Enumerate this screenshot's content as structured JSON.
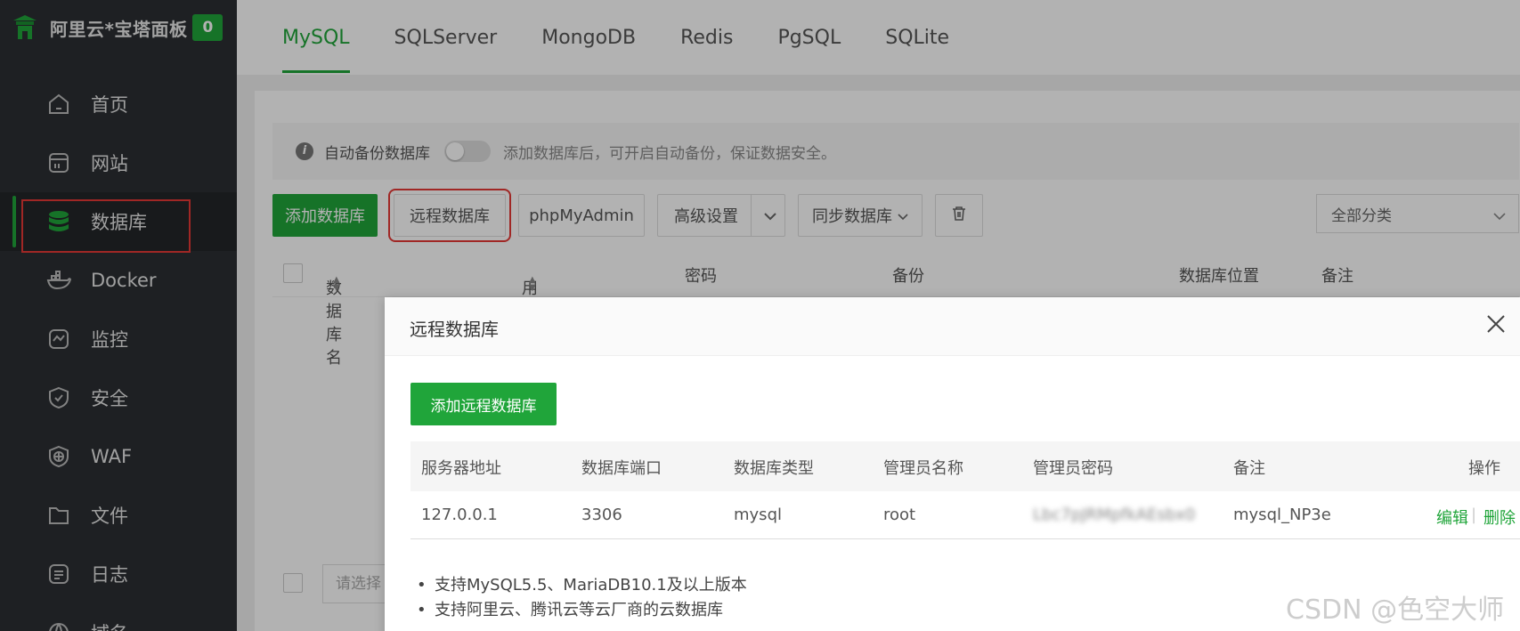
{
  "brand": {
    "name": "阿里云*宝塔面板",
    "badge": "0"
  },
  "sidebar": {
    "items": [
      {
        "label": "首页",
        "icon": "home-icon"
      },
      {
        "label": "网站",
        "icon": "website-icon"
      },
      {
        "label": "数据库",
        "icon": "database-icon",
        "active": true
      },
      {
        "label": "Docker",
        "icon": "docker-icon"
      },
      {
        "label": "监控",
        "icon": "monitor-icon"
      },
      {
        "label": "安全",
        "icon": "shield-icon"
      },
      {
        "label": "WAF",
        "icon": "waf-icon"
      },
      {
        "label": "文件",
        "icon": "folder-icon"
      },
      {
        "label": "日志",
        "icon": "log-icon"
      },
      {
        "label": "域名",
        "icon": "globe-icon"
      }
    ]
  },
  "tabs": [
    "MySQL",
    "SQLServer",
    "MongoDB",
    "Redis",
    "PgSQL",
    "SQLite"
  ],
  "notice": {
    "label": "自动备份数据库",
    "hint": "添加数据库后，可开启自动备份，保证数据安全。"
  },
  "toolbar": {
    "add_db": "添加数据库",
    "remote_db": "远程数据库",
    "phpmyadmin": "phpMyAdmin",
    "advanced": "高级设置",
    "sync": "同步数据库",
    "category": "全部分类"
  },
  "table": {
    "headers": [
      "数据库名",
      "用户名",
      "密码",
      "备份",
      "数据库位置",
      "备注"
    ]
  },
  "bottom": {
    "placeholder": "请选择"
  },
  "dialog": {
    "title": "远程数据库",
    "add_button": "添加远程数据库",
    "headers": [
      "服务器地址",
      "数据库端口",
      "数据库类型",
      "管理员名称",
      "管理员密码",
      "备注",
      "操作"
    ],
    "rows": [
      {
        "host": "127.0.0.1",
        "port": "3306",
        "type": "mysql",
        "admin": "root",
        "password": "Lbc7pJRMpfkAEsbx0",
        "note": "mysql_NP3e",
        "edit": "编辑",
        "delete": "删除"
      }
    ],
    "notes": [
      "支持MySQL5.5、MariaDB10.1及以上版本",
      "支持阿里云、腾讯云等云厂商的云数据库"
    ]
  },
  "watermark": "CSDN @色空大师",
  "colors": {
    "accent": "#20a53a",
    "highlight": "#e53935",
    "sidebar": "#2b2f33"
  }
}
